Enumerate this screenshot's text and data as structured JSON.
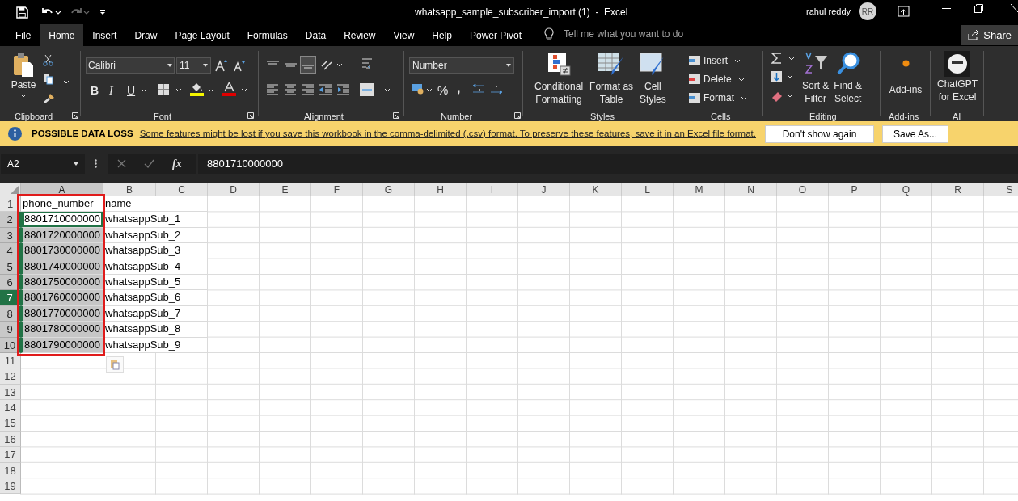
{
  "title_bar": {
    "title": "whatsapp_sample_subscriber_import (1)  -  Excel",
    "user": "rahul reddy",
    "initials": "RR"
  },
  "tabs": [
    {
      "label": "File",
      "selected": false
    },
    {
      "label": "Home",
      "selected": true
    },
    {
      "label": "Insert",
      "selected": false
    },
    {
      "label": "Draw",
      "selected": false
    },
    {
      "label": "Page Layout",
      "selected": false
    },
    {
      "label": "Formulas",
      "selected": false
    },
    {
      "label": "Data",
      "selected": false
    },
    {
      "label": "Review",
      "selected": false
    },
    {
      "label": "View",
      "selected": false
    },
    {
      "label": "Help",
      "selected": false
    },
    {
      "label": "Power Pivot",
      "selected": false
    }
  ],
  "search": {
    "placeholder": "Tell me what you want to do"
  },
  "share_button": "Share",
  "ribbon": {
    "clipboard": {
      "name": "Clipboard",
      "paste": "Paste"
    },
    "font": {
      "name": "Font",
      "font_name": "Calibri",
      "font_size": "11",
      "bold": "B",
      "italic": "I",
      "underline": "U"
    },
    "alignment": {
      "name": "Alignment"
    },
    "number": {
      "name": "Number",
      "format": "Number",
      "percent": "%",
      "comma": ","
    },
    "styles": {
      "name": "Styles",
      "buttons": [
        [
          "Conditional",
          "Formatting"
        ],
        [
          "Format as",
          "Table"
        ],
        [
          "Cell",
          "Styles"
        ]
      ]
    },
    "cells": {
      "name": "Cells",
      "buttons": [
        "Insert",
        "Delete",
        "Format"
      ]
    },
    "editing": {
      "name": "Editing",
      "buttons": [
        [
          "Sort &",
          "Filter"
        ],
        [
          "Find &",
          "Select"
        ]
      ]
    },
    "add_ins": {
      "name": "Add-ins",
      "button": "Add-ins"
    },
    "ai": {
      "name": "AI",
      "button": [
        "ChatGPT",
        "for Excel"
      ]
    }
  },
  "info_bar": {
    "title": "POSSIBLE DATA LOSS",
    "message": "Some features might be lost if you save this workbook in the comma-delimited (.csv) format. To preserve these features, save it in an Excel file format.",
    "buttons": [
      "Don't show again",
      "Save As..."
    ]
  },
  "formula_bar": {
    "name_box": "A2",
    "fx": "fx",
    "value": "8801710000000"
  },
  "sheet": {
    "annotation_box": true,
    "columns": [
      {
        "label": "A",
        "selected": true
      },
      {
        "label": "B",
        "selected": false
      },
      {
        "label": "C",
        "selected": false
      },
      {
        "label": "D",
        "selected": false
      },
      {
        "label": "E",
        "selected": false
      },
      {
        "label": "F",
        "selected": false
      },
      {
        "label": "G",
        "selected": false
      },
      {
        "label": "H",
        "selected": false
      },
      {
        "label": "I",
        "selected": false
      },
      {
        "label": "J",
        "selected": false
      },
      {
        "label": "K",
        "selected": false
      },
      {
        "label": "L",
        "selected": false
      },
      {
        "label": "M",
        "selected": false
      },
      {
        "label": "N",
        "selected": false
      },
      {
        "label": "O",
        "selected": false
      },
      {
        "label": "P",
        "selected": false
      },
      {
        "label": "Q",
        "selected": false
      },
      {
        "label": "R",
        "selected": false
      },
      {
        "label": "S",
        "selected": false
      }
    ],
    "rows": [
      {
        "label": "1",
        "selected": false,
        "current": false,
        "cells": [
          {
            "text": "phone_number",
            "selected": false,
            "active": false
          },
          {
            "text": "name",
            "selected": false,
            "active": false
          }
        ]
      },
      {
        "label": "2",
        "selected": true,
        "current": false,
        "cells": [
          {
            "text": "8801710000000",
            "selected": true,
            "active": true
          },
          {
            "text": "whatsappSub_1",
            "selected": false,
            "active": false
          }
        ]
      },
      {
        "label": "3",
        "selected": true,
        "current": false,
        "cells": [
          {
            "text": "8801720000000",
            "selected": true,
            "active": false
          },
          {
            "text": "whatsappSub_2",
            "selected": false,
            "active": false
          }
        ]
      },
      {
        "label": "4",
        "selected": true,
        "current": false,
        "cells": [
          {
            "text": "8801730000000",
            "selected": true,
            "active": false
          },
          {
            "text": "whatsappSub_3",
            "selected": false,
            "active": false
          }
        ]
      },
      {
        "label": "5",
        "selected": true,
        "current": false,
        "cells": [
          {
            "text": "8801740000000",
            "selected": true,
            "active": false
          },
          {
            "text": "whatsappSub_4",
            "selected": false,
            "active": false
          }
        ]
      },
      {
        "label": "6",
        "selected": true,
        "current": false,
        "cells": [
          {
            "text": "8801750000000",
            "selected": true,
            "active": false
          },
          {
            "text": "whatsappSub_5",
            "selected": false,
            "active": false
          }
        ]
      },
      {
        "label": "7",
        "selected": true,
        "current": true,
        "cells": [
          {
            "text": "8801760000000",
            "selected": true,
            "active": false
          },
          {
            "text": "whatsappSub_6",
            "selected": false,
            "active": false
          }
        ]
      },
      {
        "label": "8",
        "selected": true,
        "current": false,
        "cells": [
          {
            "text": "8801770000000",
            "selected": true,
            "active": false
          },
          {
            "text": "whatsappSub_7",
            "selected": false,
            "active": false
          }
        ]
      },
      {
        "label": "9",
        "selected": true,
        "current": false,
        "cells": [
          {
            "text": "8801780000000",
            "selected": true,
            "active": false
          },
          {
            "text": "whatsappSub_8",
            "selected": false,
            "active": false
          }
        ]
      },
      {
        "label": "10",
        "selected": true,
        "current": false,
        "cells": [
          {
            "text": "8801790000000",
            "selected": true,
            "active": false
          },
          {
            "text": "whatsappSub_9",
            "selected": false,
            "active": false
          }
        ]
      },
      {
        "label": "11",
        "selected": false,
        "current": false
      },
      {
        "label": "12",
        "selected": false,
        "current": false
      },
      {
        "label": "13",
        "selected": false,
        "current": false
      },
      {
        "label": "14",
        "selected": false,
        "current": false
      },
      {
        "label": "15",
        "selected": false,
        "current": false
      },
      {
        "label": "16",
        "selected": false,
        "current": false
      },
      {
        "label": "17",
        "selected": false,
        "current": false
      },
      {
        "label": "18",
        "selected": false,
        "current": false
      },
      {
        "label": "19",
        "selected": false,
        "current": false
      }
    ]
  }
}
